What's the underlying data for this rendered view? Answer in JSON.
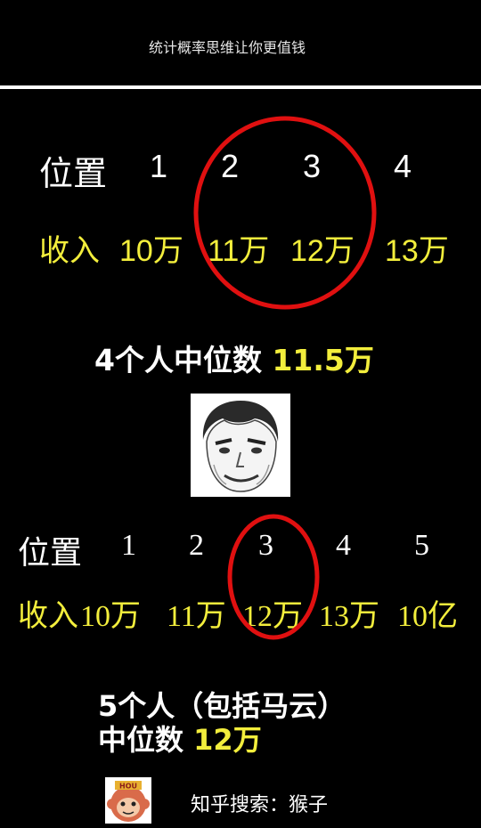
{
  "header": {
    "title": "统计概率思维让你更值钱"
  },
  "example1": {
    "position_label": "位置",
    "positions": [
      "1",
      "2",
      "3",
      "4"
    ],
    "income_label": "收入",
    "incomes": [
      "10万",
      "11万",
      "12万",
      "13万"
    ],
    "median_text": "4个人中位数",
    "median_value": "11.5万"
  },
  "example2": {
    "position_label": "位置",
    "positions": [
      "1",
      "2",
      "3",
      "4",
      "5"
    ],
    "income_label": "收入",
    "incomes": [
      "10万",
      "11万",
      "12万",
      "13万",
      "10亿"
    ],
    "line1": "5个人（包括马云）",
    "median_text": "中位数",
    "median_value": "12万"
  },
  "footer": {
    "text": "知乎搜索：猴子",
    "avatar_text": "HOU"
  },
  "colors": {
    "background": "#000000",
    "highlight": "#f3ee3c",
    "circle": "#e01010",
    "text": "#ffffff"
  }
}
